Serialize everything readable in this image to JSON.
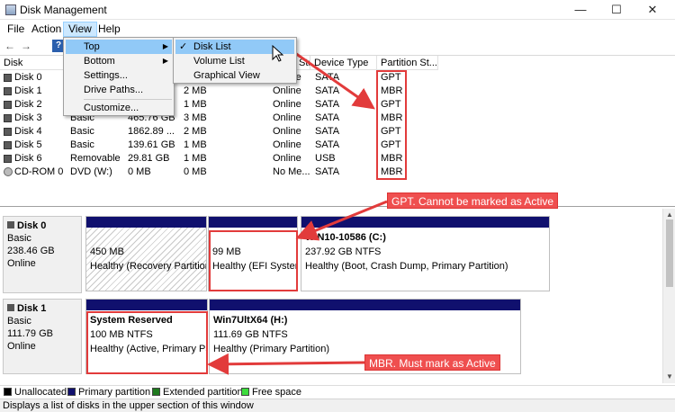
{
  "window": {
    "title": "Disk Management",
    "controls": [
      "—",
      "☐",
      "✕"
    ]
  },
  "menubar": [
    "File",
    "Action",
    "View",
    "Help"
  ],
  "columns": [
    "Disk",
    "",
    "",
    "",
    "Status",
    "Device Type",
    "Partition St..."
  ],
  "volume_rows": [
    {
      "disk": "Disk 0",
      "type": "",
      "capacity": "",
      "unalloc": "",
      "status": "Online",
      "device": "SATA",
      "pstyle": "GPT"
    },
    {
      "disk": "Disk 1",
      "type": "",
      "capacity": "",
      "unalloc": "2 MB",
      "status": "Online",
      "device": "SATA",
      "pstyle": "MBR"
    },
    {
      "disk": "Disk 2",
      "type": "",
      "capacity": "",
      "unalloc": "1 MB",
      "status": "Online",
      "device": "SATA",
      "pstyle": "GPT"
    },
    {
      "disk": "Disk 3",
      "type": "Basic",
      "capacity": "465.76 GB",
      "unalloc": "3 MB",
      "status": "Online",
      "device": "SATA",
      "pstyle": "MBR"
    },
    {
      "disk": "Disk 4",
      "type": "Basic",
      "capacity": "1862.89 ...",
      "unalloc": "2 MB",
      "status": "Online",
      "device": "SATA",
      "pstyle": "GPT"
    },
    {
      "disk": "Disk 5",
      "type": "Basic",
      "capacity": "139.61 GB",
      "unalloc": "1 MB",
      "status": "Online",
      "device": "SATA",
      "pstyle": "GPT"
    },
    {
      "disk": "Disk 6",
      "type": "Removable",
      "capacity": "29.81 GB",
      "unalloc": "1 MB",
      "status": "Online",
      "device": "USB",
      "pstyle": "MBR"
    },
    {
      "disk": "CD-ROM 0",
      "type": "DVD (W:)",
      "capacity": "0 MB",
      "unalloc": "0 MB",
      "status": "No Me...",
      "device": "SATA",
      "pstyle": "MBR"
    }
  ],
  "view_menu": {
    "items": [
      {
        "label": "Top",
        "submenu": true
      },
      {
        "label": "Bottom",
        "submenu": true
      },
      {
        "label": "Settings...",
        "submenu": false
      },
      {
        "label": "Drive Paths...",
        "submenu": false
      },
      {
        "label": "Customize...",
        "submenu": false
      }
    ],
    "top_submenu": [
      "Disk List",
      "Volume List",
      "Graphical View"
    ],
    "checked": "Disk List"
  },
  "disks": [
    {
      "name": "Disk 0",
      "type": "Basic",
      "size": "238.46 GB",
      "status": "Online",
      "partitions": [
        {
          "name": "",
          "size": "450 MB",
          "status": "Healthy (Recovery Partition"
        },
        {
          "name": "",
          "size": "99 MB",
          "status": "Healthy (EFI System"
        },
        {
          "name": "WIN10-10586  (C:)",
          "size": "237.92 GB NTFS",
          "status": "Healthy (Boot, Crash Dump, Primary Partition)"
        }
      ]
    },
    {
      "name": "Disk 1",
      "type": "Basic",
      "size": "111.79 GB",
      "status": "Online",
      "partitions": [
        {
          "name": "System Reserved",
          "size": "100 MB NTFS",
          "status": "Healthy (Active, Primary Pa"
        },
        {
          "name": "Win7UltX64  (H:)",
          "size": "111.69 GB NTFS",
          "status": "Healthy (Primary Partition)"
        }
      ]
    }
  ],
  "legend": [
    {
      "label": "Unallocated",
      "color": "#000000"
    },
    {
      "label": "Primary partition",
      "color": "#10106e"
    },
    {
      "label": "Extended partition",
      "color": "#1e7a1e"
    },
    {
      "label": "Free space",
      "color": "#3cdc3c"
    }
  ],
  "status_bar": "Displays a list of disks in the upper section of this window",
  "annotations": {
    "gpt_note": "GPT. Cannot be marked as Active",
    "mbr_note": "MBR. Must mark as Active",
    "color": "#e23b3b"
  },
  "icons": [
    "back-icon",
    "forward-icon",
    "help-icon",
    "disk-icon",
    "cdrom-icon",
    "check-icon",
    "mouse-cursor-icon"
  ]
}
